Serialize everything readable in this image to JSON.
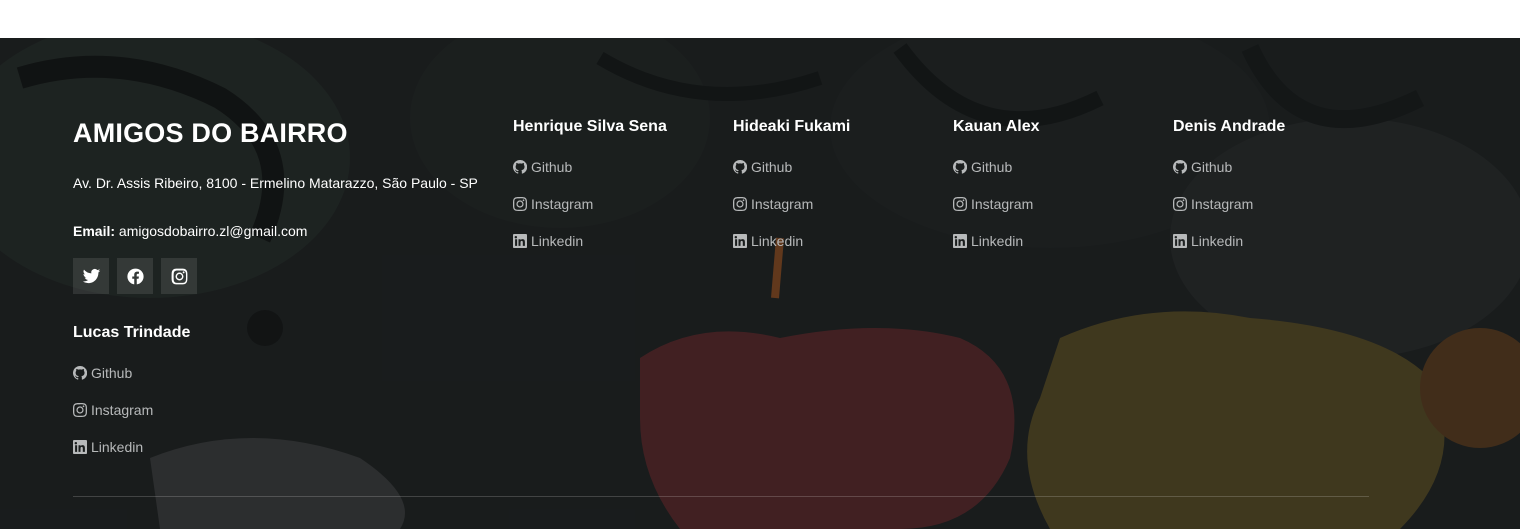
{
  "footer": {
    "brand": "AMIGOS DO BAIRRO",
    "address": "Av. Dr. Assis Ribeiro, 8100 - Ermelino Matarazzo, São Paulo - SP",
    "email_label": "Email:",
    "email_value": "amigosdobairro.zl@gmail.com",
    "socials": [
      {
        "icon": "twitter-icon"
      },
      {
        "icon": "facebook-icon"
      },
      {
        "icon": "instagram-icon"
      }
    ]
  },
  "members": [
    {
      "name": "Henrique Silva Sena",
      "links": [
        "Github",
        "Instagram",
        "Linkedin"
      ]
    },
    {
      "name": "Hideaki Fukami",
      "links": [
        "Github",
        "Instagram",
        "Linkedin"
      ]
    },
    {
      "name": "Kauan Alex",
      "links": [
        "Github",
        "Instagram",
        "Linkedin"
      ]
    },
    {
      "name": "Denis Andrade",
      "links": [
        "Github",
        "Instagram",
        "Linkedin"
      ]
    },
    {
      "name": "Lucas Trindade",
      "links": [
        "Github",
        "Instagram",
        "Linkedin"
      ]
    }
  ],
  "colors": {
    "background": "#1b1d1e",
    "text": "#ffffff",
    "link": "#b7b9ba"
  }
}
